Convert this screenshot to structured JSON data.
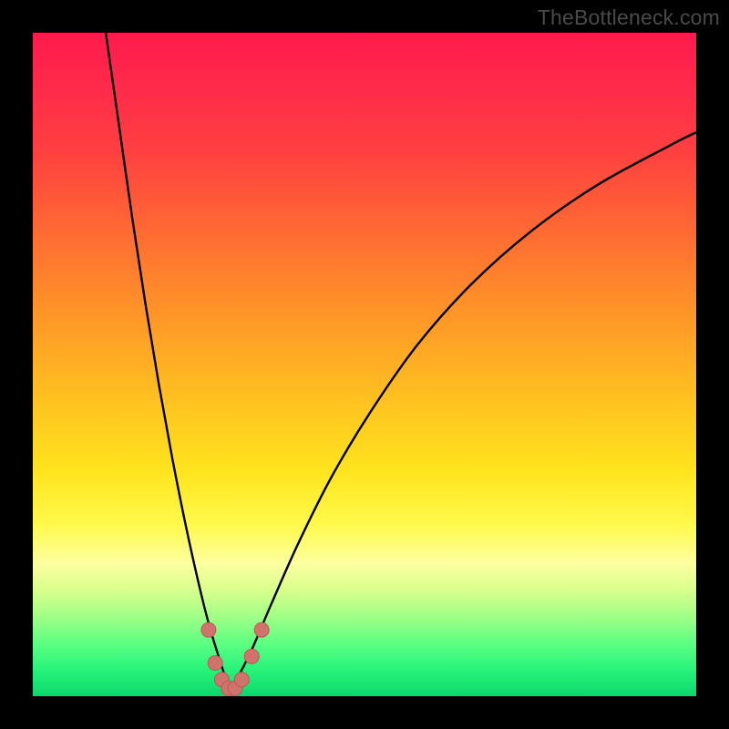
{
  "watermark": "TheBottleneck.com",
  "colors": {
    "frame": "#000000",
    "curve": "#000000",
    "marker_fill": "#d1736c",
    "marker_stroke": "#b85a55",
    "gradient_stops": [
      "#ff1a4d",
      "#ff2a4a",
      "#ff4040",
      "#ff6a33",
      "#ff9428",
      "#ffc020",
      "#ffe41e",
      "#fff94a",
      "#fdffa0",
      "#d8ff8c",
      "#a0ff86",
      "#5dff82",
      "#27f47a",
      "#0cd66c"
    ]
  },
  "chart_data": {
    "type": "line",
    "title": "",
    "xlabel": "",
    "ylabel": "",
    "xlim": [
      0,
      100
    ],
    "ylim": [
      0,
      100
    ],
    "grid": false,
    "legend": false,
    "series": [
      {
        "name": "left-branch",
        "x": [
          11,
          13,
          15,
          17,
          19,
          21,
          23,
          25,
          26.5,
          28,
          29,
          30
        ],
        "y": [
          100,
          86,
          72,
          59,
          47,
          36,
          26,
          17,
          11,
          6,
          3,
          1
        ]
      },
      {
        "name": "right-branch",
        "x": [
          30,
          31,
          33,
          36,
          40,
          45,
          51,
          58,
          66,
          75,
          85,
          96,
          100
        ],
        "y": [
          1,
          3,
          7,
          14,
          23,
          33,
          43,
          53,
          62,
          70,
          77,
          83,
          85
        ]
      }
    ],
    "markers": {
      "name": "bottom-cluster",
      "points": [
        {
          "x": 26.5,
          "y": 10
        },
        {
          "x": 27.5,
          "y": 5
        },
        {
          "x": 28.5,
          "y": 2.5
        },
        {
          "x": 29.5,
          "y": 1.2
        },
        {
          "x": 30.5,
          "y": 1.2
        },
        {
          "x": 31.5,
          "y": 2.5
        },
        {
          "x": 33.0,
          "y": 6
        },
        {
          "x": 34.5,
          "y": 10
        }
      ],
      "radius": 8
    }
  }
}
